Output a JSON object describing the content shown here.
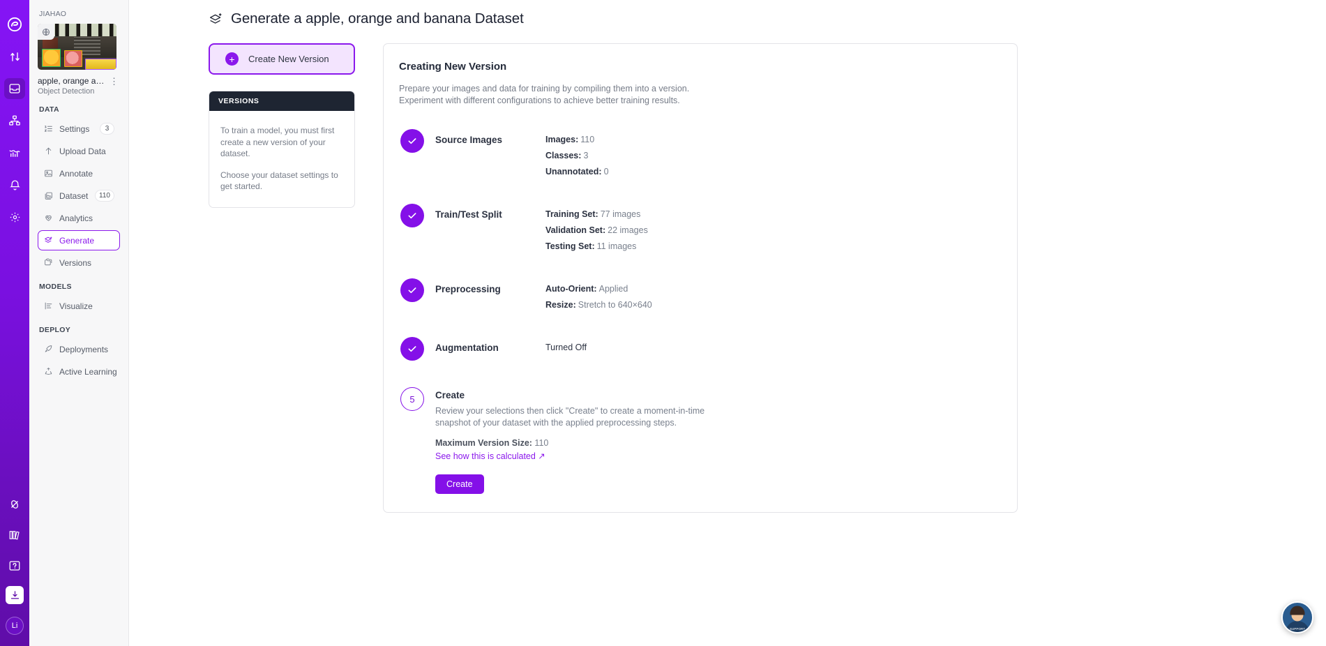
{
  "rail": {
    "items": [
      {
        "name": "roboflow-logo-icon",
        "label": "Roboflow"
      },
      {
        "name": "transfer-icon",
        "label": "Transfer"
      },
      {
        "name": "projects-inbox-icon",
        "label": "Projects"
      },
      {
        "name": "workflows-icon",
        "label": "Workflows"
      },
      {
        "name": "analytics-chart-icon",
        "label": "Analytics"
      },
      {
        "name": "notifications-bell-icon",
        "label": "Notifications"
      },
      {
        "name": "settings-gear-icon",
        "label": "Settings"
      },
      {
        "name": "universe-icon",
        "label": "Universe"
      },
      {
        "name": "library-icon",
        "label": "Library"
      },
      {
        "name": "help-question-icon",
        "label": "Help"
      },
      {
        "name": "download-icon",
        "label": "Download"
      }
    ],
    "avatar_initials": "Li"
  },
  "sidebar": {
    "org": "JIAHAO",
    "project": {
      "name": "apple, orange an...",
      "type": "Object Detection",
      "thumbnail_alt": "fruit market annotated sample",
      "visibility_icon": "globe-icon",
      "menu_icon": "kebab-menu-icon"
    },
    "sections": [
      {
        "label": "DATA",
        "items": [
          {
            "label": "Settings",
            "icon": "ordered-list-icon",
            "badge": "3",
            "active": false
          },
          {
            "label": "Upload Data",
            "icon": "upload-arrow-icon",
            "badge": "",
            "active": false
          },
          {
            "label": "Annotate",
            "icon": "annotate-image-icon",
            "badge": "",
            "active": false
          },
          {
            "label": "Dataset",
            "icon": "images-stack-icon",
            "badge": "110",
            "active": false
          },
          {
            "label": "Analytics",
            "icon": "heart-pulse-icon",
            "badge": "",
            "active": false
          },
          {
            "label": "Generate",
            "icon": "layers-plus-icon",
            "badge": "",
            "active": true
          },
          {
            "label": "Versions",
            "icon": "folders-icon",
            "badge": "",
            "active": false
          }
        ]
      },
      {
        "label": "MODELS",
        "items": [
          {
            "label": "Visualize",
            "icon": "bar-list-icon",
            "badge": "",
            "active": false
          }
        ]
      },
      {
        "label": "DEPLOY",
        "items": [
          {
            "label": "Deployments",
            "icon": "rocket-icon",
            "badge": "",
            "active": false
          },
          {
            "label": "Active Learning",
            "icon": "recycle-icon",
            "badge": "",
            "active": false
          }
        ]
      }
    ]
  },
  "page": {
    "title": "Generate a apple, orange and banana Dataset",
    "title_icon": "layers-plus-icon"
  },
  "left": {
    "create_new_version_label": "Create New Version",
    "create_new_version_icon": "plus-circle-icon",
    "versions_header": "VERSIONS",
    "versions_paragraph_1": "To train a model, you must first create a new version of your dataset.",
    "versions_paragraph_2": "Choose your dataset settings to get started."
  },
  "panel": {
    "title": "Creating New Version",
    "subtitle_line_1": "Prepare your images and data for training by compiling them into a version.",
    "subtitle_line_2": "Experiment with different configurations to achieve better training results.",
    "steps": [
      {
        "marker": "check",
        "name": "Source Images",
        "rows": [
          {
            "key": "Images:",
            "value": "110"
          },
          {
            "key": "Classes:",
            "value": "3"
          },
          {
            "key": "Unannotated:",
            "value": "0"
          }
        ]
      },
      {
        "marker": "check",
        "name": "Train/Test Split",
        "rows": [
          {
            "key": "Training Set:",
            "value": "77 images"
          },
          {
            "key": "Validation Set:",
            "value": "22 images"
          },
          {
            "key": "Testing Set:",
            "value": "11 images"
          }
        ]
      },
      {
        "marker": "check",
        "name": "Preprocessing",
        "rows": [
          {
            "key": "Auto-Orient:",
            "value": "Applied"
          },
          {
            "key": "Resize:",
            "value": "Stretch to 640×640"
          }
        ]
      },
      {
        "marker": "check",
        "name": "Augmentation",
        "rows": [
          {
            "key": "",
            "value": "Turned Off"
          }
        ]
      }
    ],
    "create_step": {
      "marker": "5",
      "name": "Create",
      "description": "Review your selections then click \"Create\" to create a moment-in-time snapshot of your dataset with the applied preprocessing steps.",
      "max_version_size_key": "Maximum Version Size:",
      "max_version_size_value": "110",
      "calc_link": "See how this is calculated ↗",
      "button_label": "Create"
    }
  },
  "help": {
    "bubble_label": "SUPPORT",
    "name": "support-chat-avatar"
  },
  "colors": {
    "accent": "#8410e8",
    "accent_light": "#f3e4fe",
    "rail_gradient_start": "#8514f5",
    "rail_gradient_end": "#5f0da8",
    "dark_header": "#1e2532",
    "text_primary": "#2c3241",
    "text_muted": "#79808d"
  }
}
